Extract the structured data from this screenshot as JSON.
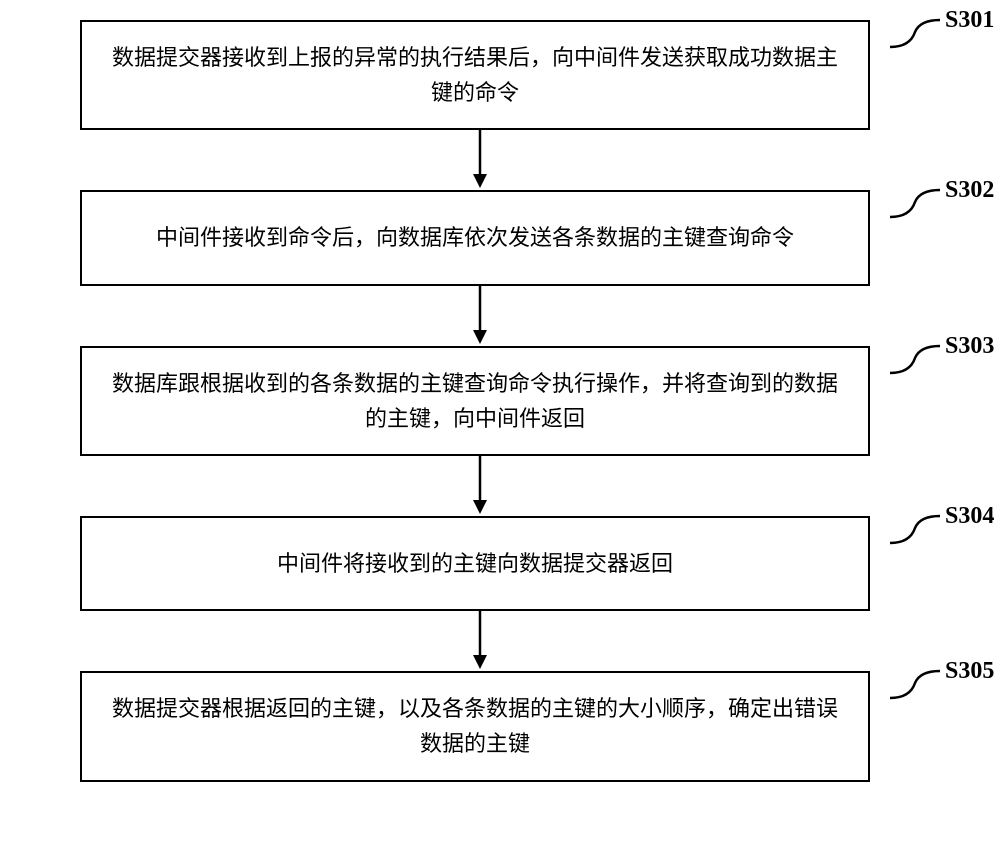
{
  "flowchart": {
    "steps": [
      {
        "label": "S301",
        "text": "数据提交器接收到上报的异常的执行结果后，向中间件发送获取成功数据主键的命令"
      },
      {
        "label": "S302",
        "text": "中间件接收到命令后，向数据库依次发送各条数据的主键查询命令"
      },
      {
        "label": "S303",
        "text": "数据库跟根据收到的各条数据的主键查询命令执行操作，并将查询到的数据的主键，向中间件返回"
      },
      {
        "label": "S304",
        "text": "中间件将接收到的主键向数据提交器返回"
      },
      {
        "label": "S305",
        "text": "数据提交器根据返回的主键，以及各条数据的主键的大小顺序，确定出错误数据的主键"
      }
    ]
  }
}
